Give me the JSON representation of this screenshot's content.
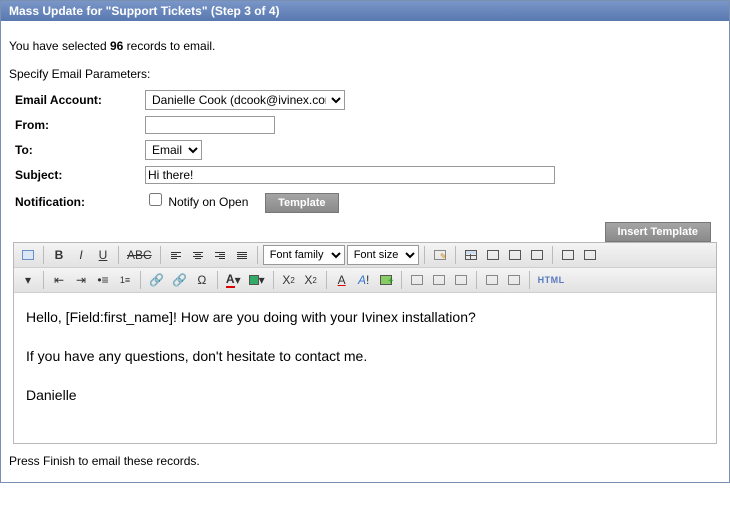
{
  "titlebar": "Mass Update for \"Support Tickets\" (Step 3 of 4)",
  "intro_prefix": "You have selected ",
  "intro_count": "96",
  "intro_suffix": " records to email.",
  "section_label": "Specify Email Parameters:",
  "form": {
    "email_account_label": "Email Account:",
    "email_account_value": "Danielle Cook (dcook@ivinex.com)",
    "from_label": "From:",
    "from_value": "",
    "to_label": "To:",
    "to_value": "Email",
    "subject_label": "Subject:",
    "subject_value": "Hi there!",
    "notification_label": "Notification:",
    "notify_on_open_label": "Notify on Open",
    "template_button": "Template"
  },
  "insert_template_button": "Insert Template",
  "toolbar": {
    "font_family_placeholder": "Font family",
    "font_size_placeholder": "Font size"
  },
  "body": {
    "p1": "Hello, [Field:first_name]! How are you doing with your Ivinex installation?",
    "p2": "If you have any questions, don't hesitate to contact me.",
    "p3": "Danielle"
  },
  "footer": "Press Finish to email these records."
}
